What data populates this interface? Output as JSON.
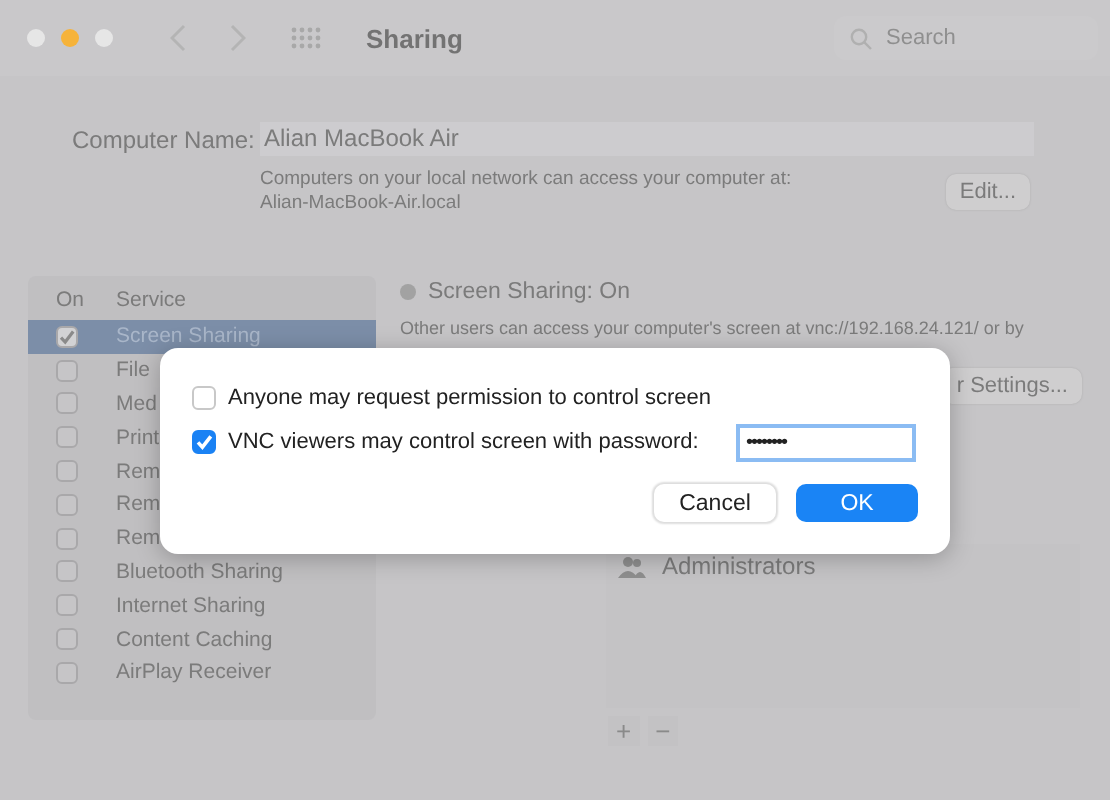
{
  "window": {
    "title": "Sharing",
    "search": {
      "placeholder": "Search"
    }
  },
  "computer_name": {
    "label": "Computer Name:",
    "value": "Alian MacBook Air",
    "note": "Computers on your local network can access your computer at:",
    "address": "Alian-MacBook-Air.local",
    "button": "Edit..."
  },
  "services": {
    "columns": [
      "On",
      "Service"
    ],
    "items": [
      {
        "name": "Screen Sharing",
        "on": true,
        "selected": true
      },
      {
        "name": "File",
        "on": false,
        "selected": false
      },
      {
        "name": "Med",
        "on": false,
        "selected": false
      },
      {
        "name": "Print",
        "on": false,
        "selected": false
      },
      {
        "name": "Rem",
        "on": false,
        "selected": false
      },
      {
        "name": "Rem",
        "on": false,
        "selected": false
      },
      {
        "name": "Rem",
        "on": false,
        "selected": false
      },
      {
        "name": "Bluetooth Sharing",
        "on": false,
        "selected": false
      },
      {
        "name": "Internet Sharing",
        "on": false,
        "selected": false
      },
      {
        "name": "Content Caching",
        "on": false,
        "selected": false
      },
      {
        "name": "AirPlay Receiver",
        "on": false,
        "selected": false
      }
    ]
  },
  "detail": {
    "status": "Screen Sharing: On",
    "description": "Other users can access your computer's screen at vnc://192.168.24.121/ or by",
    "button": "r Settings..."
  },
  "users": {
    "items": [
      "Administrators"
    ],
    "add": "+",
    "remove": "−"
  },
  "dialog": {
    "options": [
      {
        "label": "Anyone may request permission to control screen",
        "checked": false
      },
      {
        "label": "VNC viewers may control screen with password:",
        "checked": true
      }
    ],
    "password": "••••••••",
    "buttons": [
      {
        "label": "Cancel",
        "kind": "secondary"
      },
      {
        "label": "OK",
        "kind": "primary"
      }
    ]
  }
}
